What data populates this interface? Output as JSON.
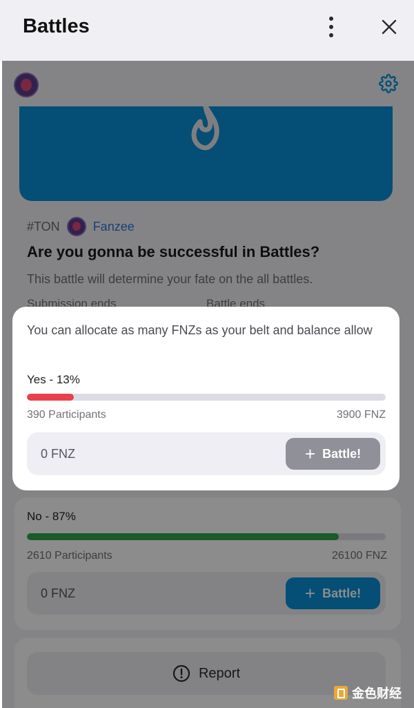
{
  "window": {
    "title": "Battles",
    "menu_icon": "kebab-menu-icon",
    "close_icon": "close-icon"
  },
  "topbar": {
    "avatar": "user-avatar",
    "settings_icon": "gear-icon"
  },
  "battle": {
    "hero_icon": "flame-icon",
    "tag": "#TON",
    "author": "Fanzee",
    "question": "Are you gonna be successful in Battles?",
    "description": "This battle will determine your fate on the all battles.",
    "submission_label": "Submission ends",
    "battle_ends_label": "Battle ends"
  },
  "popup": {
    "note": "You can allocate as many FNZs as your belt and balance allow",
    "option": {
      "label": "Yes - 13%",
      "share": 0.13,
      "participants": "390 Participants",
      "amount": "3900 FNZ",
      "stake_value": "0 FNZ",
      "button_label": "Battle!",
      "bar_color": "#e8414b",
      "button_color": "#8f9098"
    }
  },
  "option_no": {
    "label": "No - 87%",
    "share": 0.87,
    "participants": "2610 Participants",
    "amount": "26100 FNZ",
    "stake_value": "0 FNZ",
    "button_label": "Battle!",
    "bar_color": "#2fa84a",
    "button_color": "#0a8fd6"
  },
  "report": {
    "label": "Report",
    "icon": "alert-circle-icon"
  },
  "watermark": {
    "text": "金色财经"
  }
}
